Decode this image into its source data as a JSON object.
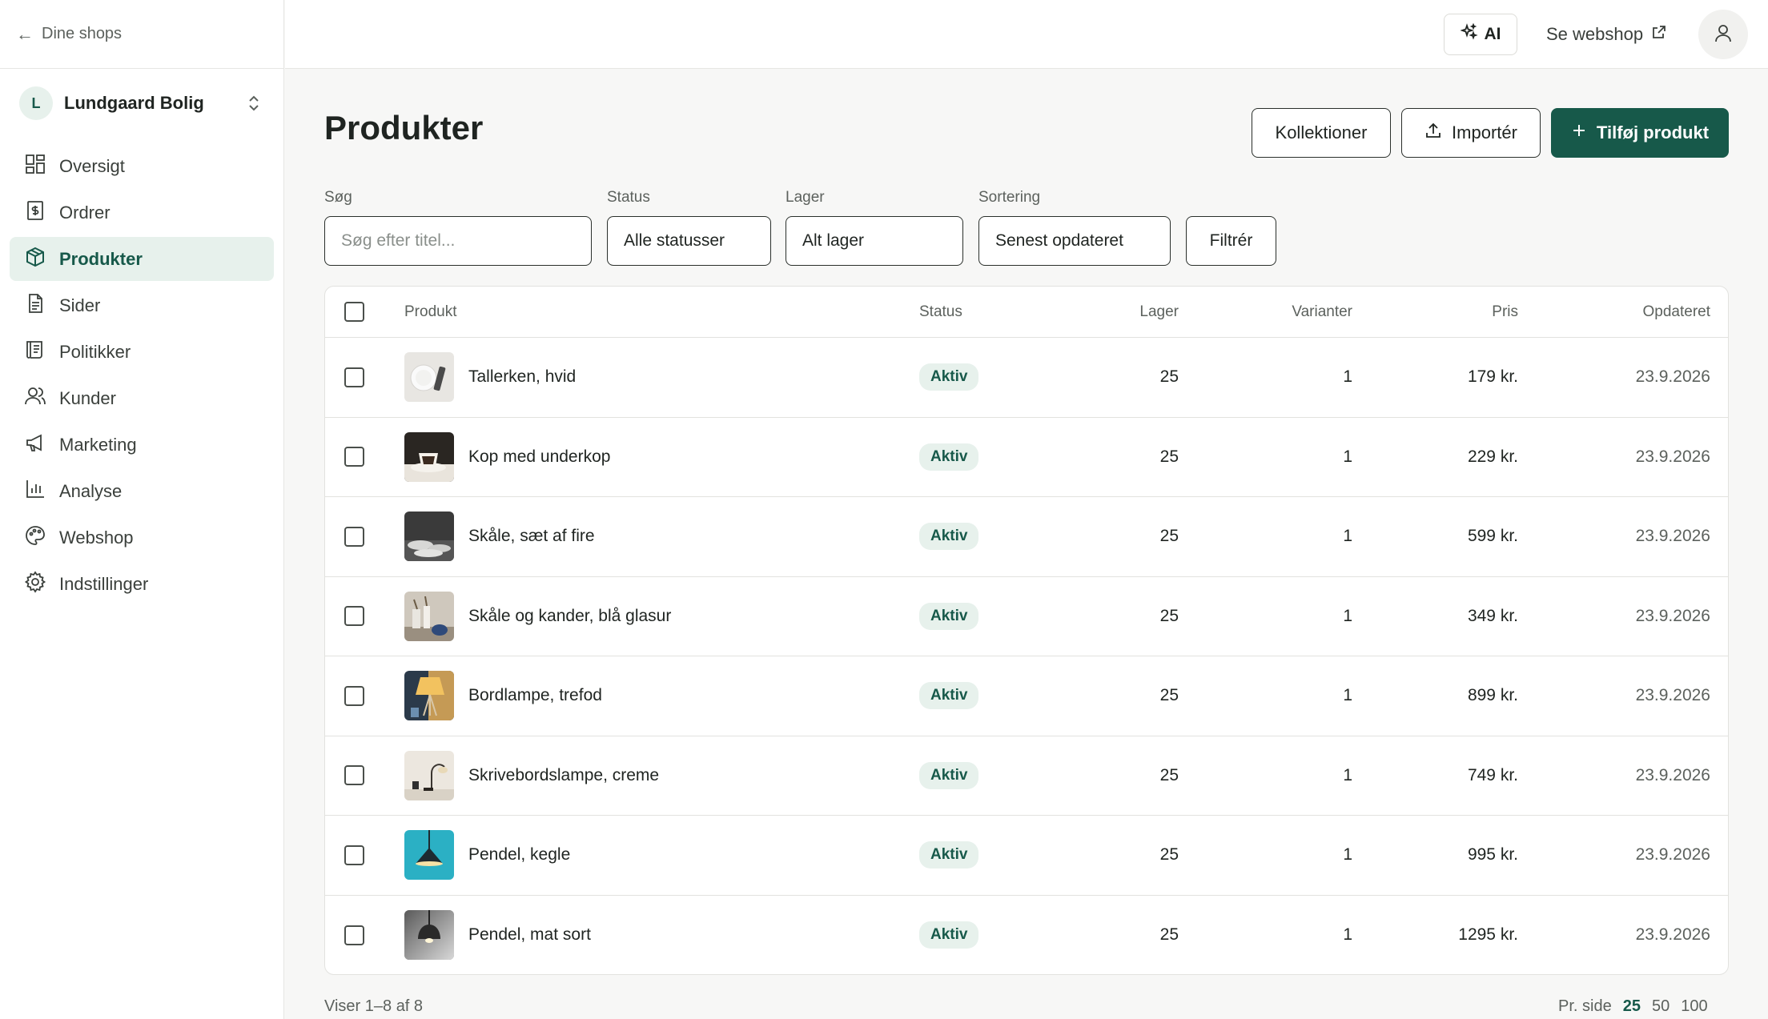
{
  "sidebar": {
    "back_label": "Dine shops",
    "shop": {
      "initial": "L",
      "name": "Lundgaard Bolig"
    },
    "items": [
      {
        "label": "Oversigt",
        "icon": "dashboard-icon"
      },
      {
        "label": "Ordrer",
        "icon": "receipt-icon"
      },
      {
        "label": "Produkter",
        "icon": "package-icon",
        "active": true
      },
      {
        "label": "Sider",
        "icon": "page-icon"
      },
      {
        "label": "Politikker",
        "icon": "scroll-icon"
      },
      {
        "label": "Kunder",
        "icon": "users-icon"
      },
      {
        "label": "Marketing",
        "icon": "megaphone-icon"
      },
      {
        "label": "Analyse",
        "icon": "bar-chart-icon"
      },
      {
        "label": "Webshop",
        "icon": "palette-icon"
      },
      {
        "label": "Indstillinger",
        "icon": "gear-icon"
      }
    ]
  },
  "topbar": {
    "ai_label": "AI",
    "webshop_label": "Se webshop"
  },
  "page": {
    "title": "Produkter",
    "buttons": {
      "collections": "Kollektioner",
      "import": "Importér",
      "add": "Tilføj produkt"
    }
  },
  "filters": {
    "search_label": "Søg",
    "search_placeholder": "Søg efter titel...",
    "status_label": "Status",
    "status_value": "Alle statusser",
    "stock_label": "Lager",
    "stock_value": "Alt lager",
    "sort_label": "Sortering",
    "sort_value": "Senest opdateret",
    "filter_button": "Filtrér"
  },
  "table": {
    "headers": {
      "product": "Produkt",
      "status": "Status",
      "stock": "Lager",
      "variants": "Varianter",
      "price": "Pris",
      "updated": "Opdateret"
    },
    "rows": [
      {
        "name": "Tallerken, hvid",
        "status": "Aktiv",
        "stock": "25",
        "variants": "1",
        "price": "179 kr.",
        "updated": "23.9.2026"
      },
      {
        "name": "Kop med underkop",
        "status": "Aktiv",
        "stock": "25",
        "variants": "1",
        "price": "229 kr.",
        "updated": "23.9.2026"
      },
      {
        "name": "Skåle, sæt af fire",
        "status": "Aktiv",
        "stock": "25",
        "variants": "1",
        "price": "599 kr.",
        "updated": "23.9.2026"
      },
      {
        "name": "Skåle og kander, blå glasur",
        "status": "Aktiv",
        "stock": "25",
        "variants": "1",
        "price": "349 kr.",
        "updated": "23.9.2026"
      },
      {
        "name": "Bordlampe, trefod",
        "status": "Aktiv",
        "stock": "25",
        "variants": "1",
        "price": "899 kr.",
        "updated": "23.9.2026"
      },
      {
        "name": "Skrivebordslampe, creme",
        "status": "Aktiv",
        "stock": "25",
        "variants": "1",
        "price": "749 kr.",
        "updated": "23.9.2026"
      },
      {
        "name": "Pendel, kegle",
        "status": "Aktiv",
        "stock": "25",
        "variants": "1",
        "price": "995 kr.",
        "updated": "23.9.2026"
      },
      {
        "name": "Pendel, mat sort",
        "status": "Aktiv",
        "stock": "25",
        "variants": "1",
        "price": "1295 kr.",
        "updated": "23.9.2026"
      }
    ]
  },
  "footer": {
    "summary": "Viser 1–8 af 8",
    "per_page_label": "Pr. side",
    "per_page_options": [
      "25",
      "50",
      "100"
    ],
    "per_page_selected": "25"
  },
  "colors": {
    "accent": "#17594a",
    "accent_soft": "#e7f1ec",
    "border": "#e2e2df"
  }
}
